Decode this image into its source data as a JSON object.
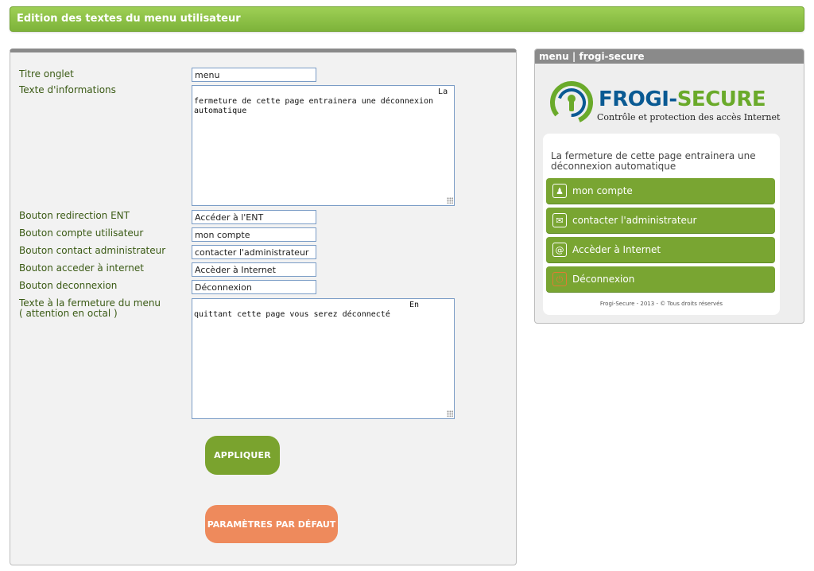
{
  "header": {
    "title": "Edition des textes du menu utilisateur"
  },
  "form": {
    "titre_onglet": {
      "label": "Titre onglet",
      "value": "menu"
    },
    "texte_informations": {
      "label": "Texte d'informations",
      "value": "                                                   La fermeture de cette page entrainera une déconnexion automatique"
    },
    "bouton_ent": {
      "label": "Bouton redirection ENT",
      "value": "Accéder à l'ENT"
    },
    "bouton_compte": {
      "label": "Bouton compte utilisateur",
      "value": "mon compte"
    },
    "bouton_contact": {
      "label": "Bouton contact administrateur",
      "value": "contacter l'administrateur"
    },
    "bouton_internet": {
      "label": "Bouton acceder à internet",
      "value": "Accèder à Internet"
    },
    "bouton_deconnexion": {
      "label": "Bouton deconnexion",
      "value": "Déconnexion"
    },
    "texte_fermeture": {
      "label_line1": "Texte à la fermeture du menu",
      "label_line2": "( attention en octal )",
      "value": "                                             En quittant cette page vous serez déconnecté"
    },
    "apply_label": "Appliquer",
    "default_label": "Paramètres par défaut"
  },
  "preview": {
    "title": "menu | frogi-secure",
    "logo": {
      "name_part1": "FROGI-",
      "name_part2": "SECURE",
      "tagline": "Contrôle et protection des accès Internet"
    },
    "info_text": "La fermeture de cette page entrainera une déconnexion automatique",
    "buttons": [
      {
        "label": "mon compte",
        "icon": "user-icon"
      },
      {
        "label": "contacter l'administrateur",
        "icon": "mail-icon"
      },
      {
        "label": "Accèder à Internet",
        "icon": "at-icon"
      },
      {
        "label": "Déconnexion",
        "icon": "power-icon"
      }
    ],
    "footer": "Frogi-Secure - 2013 - © Tous droits réservés"
  },
  "colors": {
    "green": "#79a532",
    "orange": "#ee8a5c",
    "logo_blue": "#0a5a93",
    "logo_green": "#6aaa2a"
  }
}
